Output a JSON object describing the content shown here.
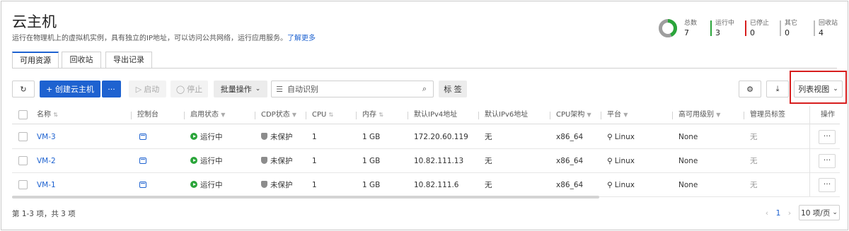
{
  "page": {
    "title": "云主机",
    "subtitle": "运行在物理机上的虚拟机实例，具有独立的IP地址，可以访问公共网络，运行应用服务。",
    "learn_more": "了解更多"
  },
  "stats": [
    {
      "label": "总数",
      "value": "7",
      "color": "#9e9e9e"
    },
    {
      "label": "运行中",
      "value": "3",
      "color": "#2aa53a"
    },
    {
      "label": "已停止",
      "value": "0",
      "color": "#d71e1e"
    },
    {
      "label": "其它",
      "value": "0",
      "color": "#bdbdbd"
    },
    {
      "label": "回收站",
      "value": "4",
      "color": "#bdbdbd"
    }
  ],
  "tabs": [
    {
      "label": "可用资源",
      "active": true
    },
    {
      "label": "回收站",
      "active": false
    },
    {
      "label": "导出记录",
      "active": false
    }
  ],
  "toolbar": {
    "refresh_icon": "refresh-icon",
    "create": "+ 创建云主机",
    "more": "···",
    "start": "启动",
    "stop": "停止",
    "batch": "批量操作",
    "search_placeholder": "自动识别",
    "tag": "标 签",
    "settings_icon": "gear-icon",
    "download_icon": "download-icon",
    "view": "列表视图"
  },
  "columns": [
    "名称",
    "控制台",
    "启用状态",
    "CDP状态",
    "CPU",
    "内存",
    "默认IPv4地址",
    "默认IPv6地址",
    "CPU架构",
    "平台",
    "高可用级别",
    "管理员标签",
    "操作"
  ],
  "rows": [
    {
      "name": "VM-3",
      "state": "运行中",
      "cdp": "未保护",
      "cpu": "1",
      "mem": "1 GB",
      "ipv4": "172.20.60.119",
      "ipv6": "无",
      "arch": "x86_64",
      "platform": "Linux",
      "ha": "None",
      "admin_tag": "无"
    },
    {
      "name": "VM-2",
      "state": "运行中",
      "cdp": "未保护",
      "cpu": "1",
      "mem": "1 GB",
      "ipv4": "10.82.111.13",
      "ipv6": "无",
      "arch": "x86_64",
      "platform": "Linux",
      "ha": "None",
      "admin_tag": "无"
    },
    {
      "name": "VM-1",
      "state": "运行中",
      "cdp": "未保护",
      "cpu": "1",
      "mem": "1 GB",
      "ipv4": "10.82.111.6",
      "ipv6": "无",
      "arch": "x86_64",
      "platform": "Linux",
      "ha": "None",
      "admin_tag": "无"
    }
  ],
  "row_more": "···",
  "footer": {
    "summary": "第 1-3 项，共 3 项",
    "current_page": "1",
    "page_size": "10 项/页"
  }
}
